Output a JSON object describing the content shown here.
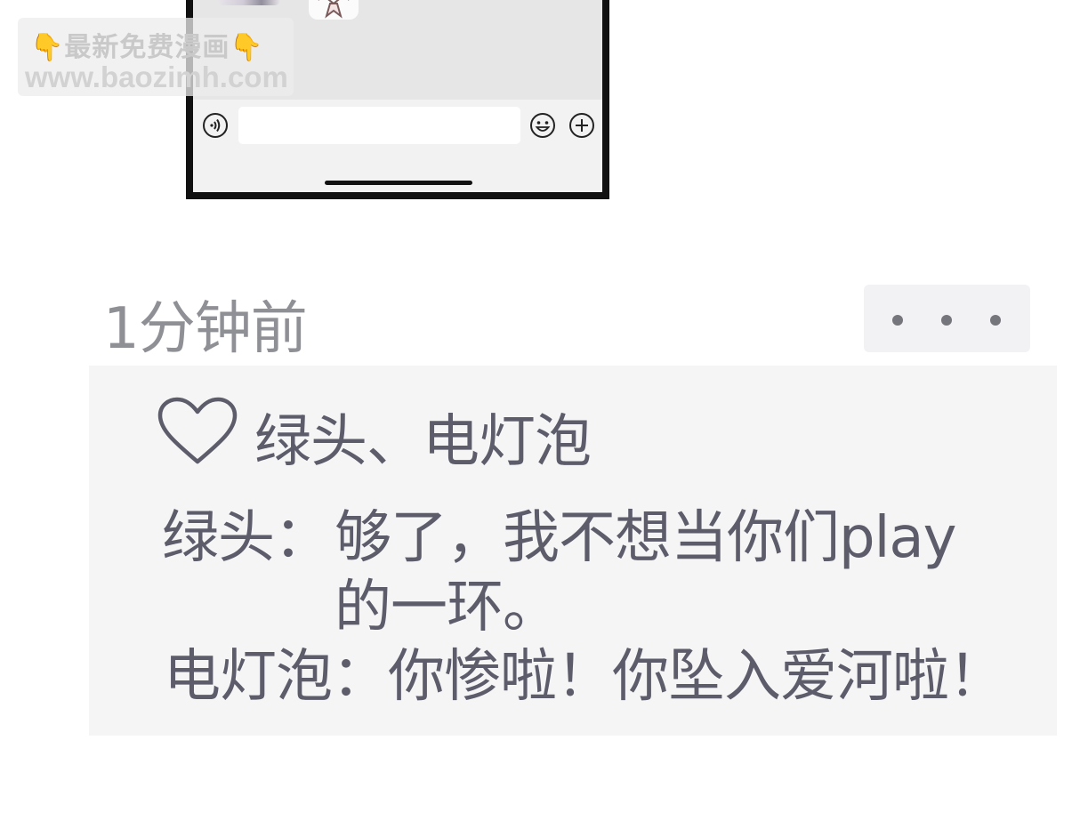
{
  "watermark": {
    "line1": "最新免费漫画",
    "line2": "www.baozimh.com",
    "hand_glyph": "👇"
  },
  "chat_preview": {
    "input": {
      "value": "",
      "placeholder": ""
    },
    "icons": {
      "voice": "voice-input-icon",
      "emoji": "emoji-icon",
      "more": "plus-icon"
    }
  },
  "post": {
    "timestamp": "1分钟前",
    "more_button_label": "· · ·",
    "likes": {
      "icon": "heart-icon",
      "names": "绿头、电灯泡"
    },
    "comments": [
      {
        "author": "绿头：",
        "text": "够了，我不想当你们play的一环。"
      },
      {
        "author": "电灯泡：",
        "text": "你惨啦！你坠入爱河啦！"
      }
    ]
  },
  "colors": {
    "text_primary": "#5c5c6b",
    "text_time": "#8f8f96",
    "panel_bg": "#f5f5f6",
    "phone_frame": "#111111",
    "accent_hand": "#f2b632"
  }
}
